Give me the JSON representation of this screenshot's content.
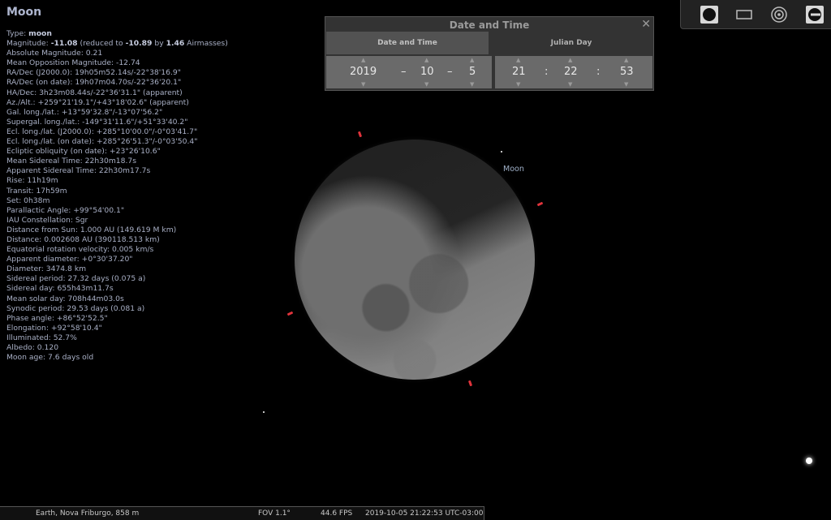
{
  "object": {
    "name": "Moon",
    "type_prefix": "Type: ",
    "type_value": "moon",
    "mag_prefix": "Magnitude: ",
    "mag_value": "-11.08",
    "mag_mid1": " (reduced to ",
    "mag_reduced": "-10.89",
    "mag_mid2": " by ",
    "mag_airmass": "1.46",
    "mag_suffix": " Airmasses)",
    "lines_a": [
      "Absolute Magnitude: 0.21",
      "Mean Opposition Magnitude: -12.74",
      "RA/Dec (J2000.0): 19h05m52.14s/-22°38'16.9\"",
      "RA/Dec (on date): 19h07m04.70s/-22°36'20.1\"",
      "HA/Dec: 3h23m08.44s/-22°36'31.1\" (apparent)",
      "Az./Alt.: +259°21'19.1\"/+43°18'02.6\" (apparent)",
      "Gal. long./lat.: +13°59'32.8\"/-13°07'56.2\"",
      "Supergal. long./lat.: -149°31'11.6\"/+51°33'40.2\"",
      "Ecl. long./lat. (J2000.0): +285°10'00.0\"/-0°03'41.7\"",
      "Ecl. long./lat. (on date): +285°26'51.3\"/-0°03'50.4\"",
      "Ecliptic obliquity (on date): +23°26'10.6\"",
      "Mean Sidereal Time: 22h30m18.7s",
      "Apparent Sidereal Time: 22h30m17.7s",
      "Rise: 11h19m",
      "Transit: 17h59m",
      "Set: 0h38m",
      "Parallactic Angle: +99°54'00.1\"",
      "IAU Constellation: Sgr",
      "Distance from Sun: 1.000 AU (149.619 M km)",
      "Distance: 0.002608 AU (390118.513 km)",
      "Equatorial rotation velocity: 0.005 km/s",
      "Apparent diameter: +0°30'37.20\"",
      "Diameter: 3474.8 km",
      "Sidereal period: 27.32 days (0.075 a)",
      "Sidereal day: 655h43m11.7s",
      "Mean solar day: 708h44m03.0s",
      "Synodic period: 29.53 days (0.081 a)",
      "Phase angle: +86°52'52.5\"",
      "Elongation: +92°58'10.4\"",
      "Illuminated: 52.7%",
      "Albedo: 0.120",
      "Moon age: 7.6 days old"
    ]
  },
  "sky": {
    "moon_label": "Moon"
  },
  "date_dialog": {
    "title": "Date and Time",
    "close": "✕",
    "tab_date": "Date and Time",
    "tab_julian": "Julian Day",
    "year": "2019",
    "sep1": "–",
    "month": "10",
    "sep2": "–",
    "day": "5",
    "hour": "21",
    "colon1": ":",
    "minute": "22",
    "colon2": ":",
    "second": "53"
  },
  "status_bar": {
    "location": "Earth, Nova Friburgo, 858 m",
    "fov": "FOV 1.1°",
    "fps": "44.6 FPS",
    "datetime": "2019-10-05 21:22:53 UTC-03:00"
  }
}
